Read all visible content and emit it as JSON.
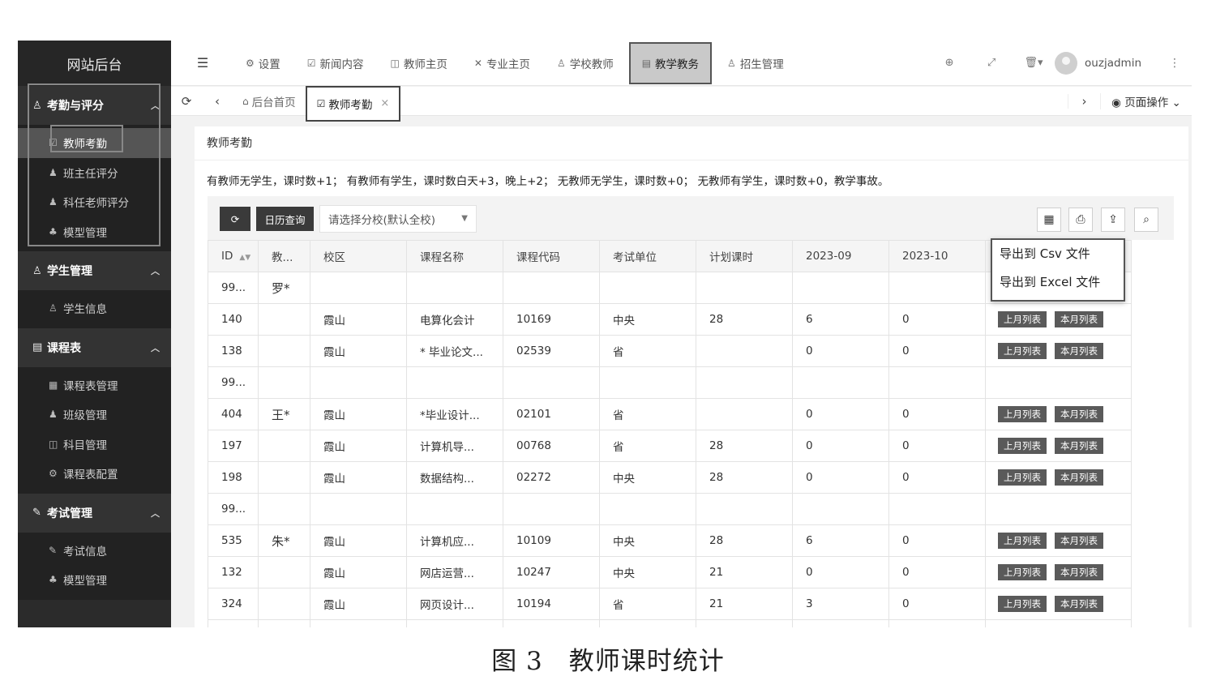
{
  "sidebar": {
    "title": "网站后台",
    "groups": [
      {
        "label": "考勤与评分",
        "icon": "user-icon",
        "items": [
          {
            "label": "教师考勤",
            "icon": "edit-icon"
          },
          {
            "label": "班主任评分",
            "icon": "user-icon"
          },
          {
            "label": "科任老师评分",
            "icon": "user-icon"
          },
          {
            "label": "模型管理",
            "icon": "sitemap-icon"
          }
        ]
      },
      {
        "label": "学生管理",
        "icon": "user-icon",
        "items": [
          {
            "label": "学生信息",
            "icon": "users-icon"
          }
        ]
      },
      {
        "label": "课程表",
        "icon": "list-icon",
        "items": [
          {
            "label": "课程表管理",
            "icon": "table-icon"
          },
          {
            "label": "班级管理",
            "icon": "user-icon"
          },
          {
            "label": "科目管理",
            "icon": "book-icon"
          },
          {
            "label": "课程表配置",
            "icon": "gear-icon"
          }
        ]
      },
      {
        "label": "考试管理",
        "icon": "pen-icon",
        "items": [
          {
            "label": "考试信息",
            "icon": "pen-icon"
          },
          {
            "label": "模型管理",
            "icon": "sitemap-icon"
          }
        ]
      }
    ]
  },
  "topnav": {
    "items": [
      {
        "label": "设置",
        "icon": "gear-icon"
      },
      {
        "label": "新闻内容",
        "icon": "edit-icon"
      },
      {
        "label": "教师主页",
        "icon": "book-icon"
      },
      {
        "label": "专业主页",
        "icon": "tools-icon"
      },
      {
        "label": "学校教师",
        "icon": "user-icon"
      },
      {
        "label": "教学教务",
        "icon": "document-icon"
      },
      {
        "label": "招生管理",
        "icon": "users-icon"
      }
    ],
    "username": "ouzjadmin"
  },
  "tabs": {
    "home": "后台首页",
    "current": "教师考勤",
    "page_ops": "页面操作"
  },
  "card": {
    "title": "教师考勤",
    "rule": "有教师无学生，课时数+1；  有教师有学生，课时数白天+3，晚上+2；  无教师无学生，课时数+0；  无教师有学生，课时数+0，教学事故。"
  },
  "toolbar": {
    "calendar_button": "日历查询",
    "campus_placeholder": "请选择分校(默认全校)"
  },
  "export_menu": {
    "csv": "导出到 Csv 文件",
    "excel": "导出到 Excel 文件"
  },
  "table": {
    "headers": [
      "ID",
      "教...",
      "校区",
      "课程名称",
      "课程代码",
      "考试单位",
      "计划课时",
      "2023-09",
      "2023-10",
      ""
    ],
    "action_prev": "上月列表",
    "action_curr": "本月列表",
    "rows": [
      {
        "id": "99...",
        "teacher": "罗*",
        "campus": "",
        "course": "",
        "code": "",
        "unit": "",
        "plan": "",
        "m09": "",
        "m10": "",
        "actions": false
      },
      {
        "id": "140",
        "teacher": "",
        "campus": "霞山",
        "course": "电算化会计",
        "code": "10169",
        "unit": "中央",
        "plan": "28",
        "m09": "6",
        "m10": "0",
        "actions": true
      },
      {
        "id": "138",
        "teacher": "",
        "campus": "霞山",
        "course": "* 毕业论文...",
        "code": "02539",
        "unit": "省",
        "plan": "",
        "m09": "0",
        "m10": "0",
        "actions": true
      },
      {
        "id": "99...",
        "teacher": "",
        "campus": "",
        "course": "",
        "code": "",
        "unit": "",
        "plan": "",
        "m09": "",
        "m10": "",
        "actions": false
      },
      {
        "id": "404",
        "teacher": "王*",
        "campus": "霞山",
        "course": "*毕业设计...",
        "code": "02101",
        "unit": "省",
        "plan": "",
        "m09": "0",
        "m10": "0",
        "actions": true
      },
      {
        "id": "197",
        "teacher": "",
        "campus": "霞山",
        "course": "计算机导...",
        "code": "00768",
        "unit": "省",
        "plan": "28",
        "m09": "0",
        "m10": "0",
        "actions": true
      },
      {
        "id": "198",
        "teacher": "",
        "campus": "霞山",
        "course": "数据结构...",
        "code": "02272",
        "unit": "中央",
        "plan": "28",
        "m09": "0",
        "m10": "0",
        "actions": true
      },
      {
        "id": "99...",
        "teacher": "",
        "campus": "",
        "course": "",
        "code": "",
        "unit": "",
        "plan": "",
        "m09": "",
        "m10": "",
        "actions": false
      },
      {
        "id": "535",
        "teacher": "朱*",
        "campus": "霞山",
        "course": "计算机应...",
        "code": "10109",
        "unit": "中央",
        "plan": "28",
        "m09": "6",
        "m10": "0",
        "actions": true
      },
      {
        "id": "132",
        "teacher": "",
        "campus": "霞山",
        "course": "网店运营...",
        "code": "10247",
        "unit": "中央",
        "plan": "21",
        "m09": "0",
        "m10": "0",
        "actions": true
      },
      {
        "id": "324",
        "teacher": "",
        "campus": "霞山",
        "course": "网页设计...",
        "code": "10194",
        "unit": "省",
        "plan": "21",
        "m09": "3",
        "m10": "0",
        "actions": true
      },
      {
        "id": "",
        "teacher": "",
        "campus": "",
        "course": "",
        "code": "",
        "unit": "",
        "plan": "",
        "m09": "",
        "m10": "",
        "actions": true
      }
    ]
  },
  "caption": "图 3　教师课时统计"
}
